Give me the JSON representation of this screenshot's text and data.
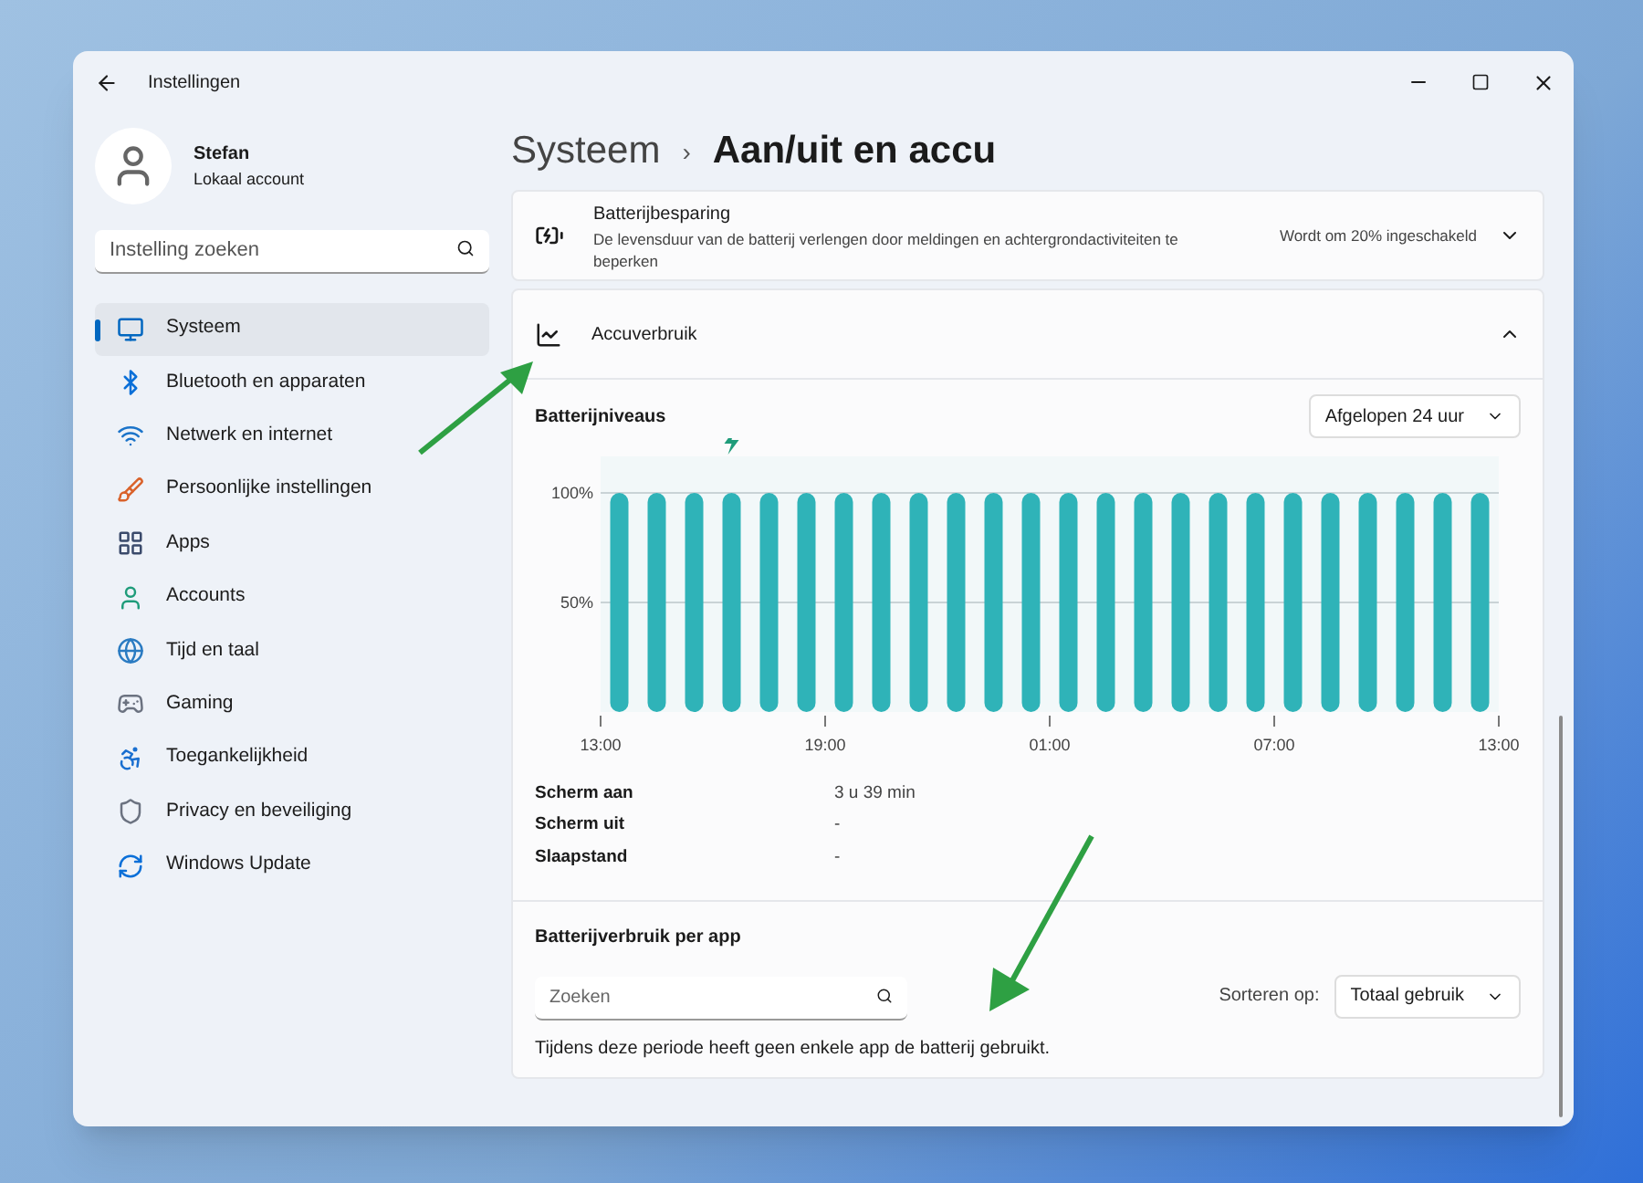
{
  "window": {
    "title": "Instellingen"
  },
  "user": {
    "name": "Stefan",
    "account": "Lokaal account"
  },
  "search": {
    "placeholder": "Instelling zoeken"
  },
  "sidebar": {
    "items": [
      {
        "label": "Systeem",
        "selected": true
      },
      {
        "label": "Bluetooth en apparaten",
        "selected": false
      },
      {
        "label": "Netwerk en internet",
        "selected": false
      },
      {
        "label": "Persoonlijke instellingen",
        "selected": false
      },
      {
        "label": "Apps",
        "selected": false
      },
      {
        "label": "Accounts",
        "selected": false
      },
      {
        "label": "Tijd en taal",
        "selected": false
      },
      {
        "label": "Gaming",
        "selected": false
      },
      {
        "label": "Toegankelijkheid",
        "selected": false
      },
      {
        "label": "Privacy en beveiliging",
        "selected": false
      },
      {
        "label": "Windows Update",
        "selected": false
      }
    ]
  },
  "breadcrumb": {
    "parent": "Systeem",
    "separator": "›",
    "current": "Aan/uit en accu"
  },
  "battery_saver": {
    "title": "Batterijbesparing",
    "description": "De levensduur van de batterij verlengen door meldingen en achtergrondactiviteiten te beperken",
    "value": "Wordt om 20% ingeschakeld",
    "expanded": false
  },
  "usage": {
    "title": "Accuverbruik",
    "expanded": true,
    "levels_title": "Batterijniveaus",
    "period": "Afgelopen 24 uur",
    "chart_data": {
      "type": "bar",
      "categories": [
        "13:00",
        null,
        null,
        null,
        null,
        null,
        "19:00",
        null,
        null,
        null,
        null,
        null,
        "01:00",
        null,
        null,
        null,
        null,
        null,
        "07:00",
        null,
        null,
        null,
        null,
        null,
        "13:00"
      ],
      "series": [
        {
          "color": "#2fb3b8",
          "values": [
            100,
            100,
            100,
            100,
            100,
            100,
            100,
            100,
            100,
            100,
            100,
            100,
            100,
            100,
            100,
            100,
            100,
            100,
            100,
            100,
            100,
            100,
            100,
            100,
            null
          ]
        }
      ],
      "ylim": [
        0,
        100
      ],
      "yticks": [
        {
          "value": 50,
          "label": "50%"
        },
        {
          "value": 100,
          "label": "100%"
        }
      ]
    },
    "stats": [
      {
        "label": "Scherm aan",
        "value": "3 u 39 min"
      },
      {
        "label": "Scherm uit",
        "value": "-"
      },
      {
        "label": "Slaapstand",
        "value": "-"
      }
    ],
    "per_app_title": "Batterijverbruik per app",
    "app_search": {
      "placeholder": "Zoeken"
    },
    "sort_label": "Sorteren op:",
    "sort_value": "Totaal gebruik",
    "empty_message": "Tijdens deze periode heeft geen enkele app de batterij gebruikt."
  }
}
